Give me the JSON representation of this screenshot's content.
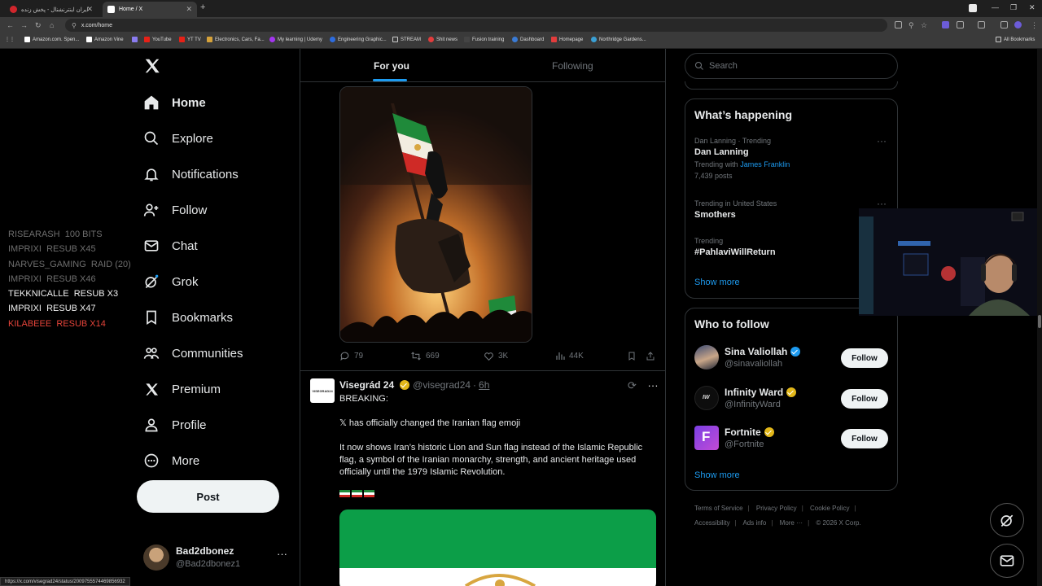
{
  "browser": {
    "tabs": [
      {
        "title": "ایران اینترنشنال - پخش زنده",
        "active": false
      },
      {
        "title": "Home / X",
        "active": true
      }
    ],
    "url": "x.com/home",
    "bookmarks": [
      "Amazon.com. Spen...",
      "Amazon Vine",
      "YouTube",
      "YT TV",
      "Electronics, Cars, Fa...",
      "My learning | Udemy",
      "Engineering Graphic...",
      "STREAM",
      "Shit news",
      "Fusion training",
      "Dashboard",
      "Homepage",
      "Northridge Gardens..."
    ],
    "all_bookmarks": "All Bookmarks",
    "status_url": "https://x.com/visegrad24/status/2009755574469856932"
  },
  "sidebar": {
    "items": [
      {
        "label": "Home",
        "icon": "home-icon",
        "active": true
      },
      {
        "label": "Explore",
        "icon": "search-icon",
        "active": false
      },
      {
        "label": "Notifications",
        "icon": "bell-icon",
        "active": false
      },
      {
        "label": "Follow",
        "icon": "follow-icon",
        "active": false
      },
      {
        "label": "Chat",
        "icon": "mail-icon",
        "active": false
      },
      {
        "label": "Grok",
        "icon": "grok-icon",
        "active": false
      },
      {
        "label": "Bookmarks",
        "icon": "bookmark-icon",
        "active": false
      },
      {
        "label": "Communities",
        "icon": "communities-icon",
        "active": false
      },
      {
        "label": "Premium",
        "icon": "x-logo-icon",
        "active": false
      },
      {
        "label": "Profile",
        "icon": "person-icon",
        "active": false
      },
      {
        "label": "More",
        "icon": "more-circle-icon",
        "active": false
      }
    ],
    "post_label": "Post",
    "account": {
      "name": "Bad2dbonez",
      "handle": "@Bad2dbonez1"
    }
  },
  "stream_overlay": [
    {
      "user": "RISEARASH",
      "event": "100 BITS",
      "style": "dim"
    },
    {
      "user": "IMPRIXI",
      "event": "RESUB X45",
      "style": "dim"
    },
    {
      "user": "NARVES_GAMING",
      "event": "RAID (20)",
      "style": "dim"
    },
    {
      "user": "IMPRIXI",
      "event": "RESUB X46",
      "style": "dim"
    },
    {
      "user": "TEKKNICALLE",
      "event": "RESUB X3",
      "style": "bright"
    },
    {
      "user": "IMPRIXI",
      "event": "RESUB X47",
      "style": "bright"
    },
    {
      "user": "KILABEEE",
      "event": "RESUB X14",
      "style": "red"
    }
  ],
  "feed": {
    "tabs": {
      "for_you": "For you",
      "following": "Following"
    },
    "post1": {
      "replies": "79",
      "reposts": "669",
      "likes": "3K",
      "views": "44K"
    },
    "post2": {
      "avatar_text": "VISEGRAD24",
      "name": "Visegrád 24",
      "handle": "@visegrad24",
      "time": "6h",
      "lines": [
        "BREAKING:",
        "𝕏 has officially changed the Iranian flag emoji",
        "It now shows Iran’s historic Lion and Sun flag instead of the Islamic Republic flag, a symbol of the Iranian monarchy, strength, and ancient heritage used officially until the 1979 Islamic Revolution."
      ]
    }
  },
  "right": {
    "search_placeholder": "Search",
    "whats_happening": {
      "title": "What’s happening",
      "trends": [
        {
          "context": "Dan Lanning · Trending",
          "name": "Dan Lanning",
          "with_prefix": "Trending with",
          "with_link": "James Franklin",
          "posts": "7,439 posts"
        },
        {
          "context": "Trending in United States",
          "name": "Smothers"
        },
        {
          "context": "Trending",
          "name": "#PahlaviWillReturn"
        }
      ],
      "show_more": "Show more"
    },
    "who_to_follow": {
      "title": "Who to follow",
      "accounts": [
        {
          "name": "Sina Valiollah",
          "handle": "@sinavaliollah",
          "badge": "blue",
          "button": "Follow"
        },
        {
          "name": "Infinity Ward",
          "handle": "@InfinityWard",
          "badge": "gold",
          "button": "Follow"
        },
        {
          "name": "Fortnite",
          "handle": "@Fortnite",
          "badge": "gold",
          "button": "Follow"
        }
      ],
      "show_more": "Show more"
    },
    "footer": {
      "row1": [
        "Terms of Service",
        "Privacy Policy",
        "Cookie Policy"
      ],
      "row2": [
        "Accessibility",
        "Ads info",
        "More ···",
        "© 2026 X Corp."
      ]
    }
  },
  "colors": {
    "accent": "#1d9bf0",
    "background": "#000000",
    "border": "#2f3336",
    "muted": "#71767b",
    "overlay_red": "#e6443a"
  }
}
